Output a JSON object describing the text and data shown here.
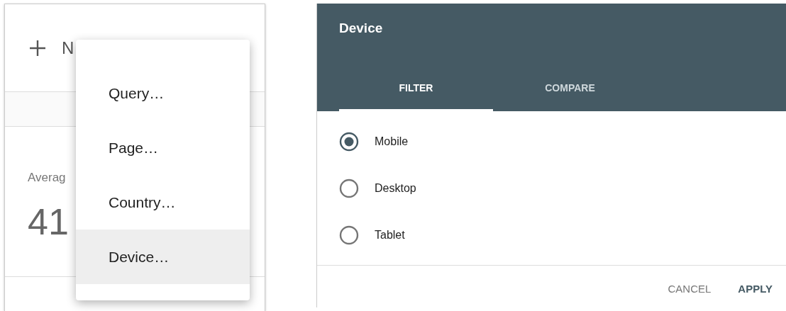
{
  "background_page": {
    "new_button": "N",
    "metric_label": "Averag",
    "metric_value": "41"
  },
  "menu": {
    "items": [
      {
        "label": "Query…",
        "selected": false
      },
      {
        "label": "Page…",
        "selected": false
      },
      {
        "label": "Country…",
        "selected": false
      },
      {
        "label": "Device…",
        "selected": true
      }
    ]
  },
  "dialog": {
    "title": "Device",
    "tabs": [
      {
        "label": "FILTER",
        "selected": true
      },
      {
        "label": "COMPARE",
        "selected": false
      }
    ],
    "options": [
      {
        "label": "Mobile",
        "selected": true
      },
      {
        "label": "Desktop",
        "selected": false
      },
      {
        "label": "Tablet",
        "selected": false
      }
    ],
    "buttons": [
      {
        "label": "CANCEL",
        "kind": "secondary"
      },
      {
        "label": "APPLY",
        "kind": "primary"
      }
    ]
  }
}
